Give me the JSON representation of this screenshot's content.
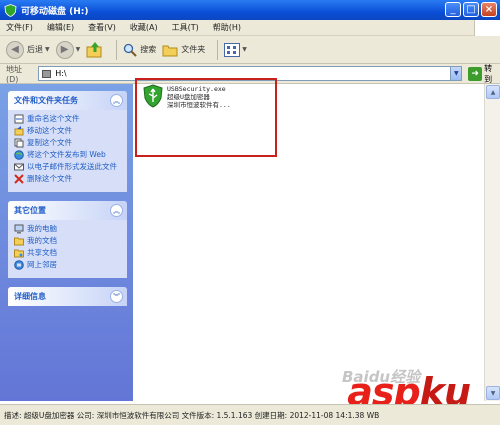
{
  "window": {
    "title": "可移动磁盘 (H:)",
    "buttons": {
      "minimize": "_",
      "maximize": "□",
      "close": "×"
    }
  },
  "menu": [
    "文件(F)",
    "编辑(E)",
    "查看(V)",
    "收藏(A)",
    "工具(T)",
    "帮助(H)"
  ],
  "toolbar": {
    "back_label": "后退",
    "search_label": "搜索",
    "folders_label": "文件夹"
  },
  "address": {
    "label": "地址(D)",
    "value": "H:\\",
    "go_label": "转到"
  },
  "tasks_panel": {
    "title": "文件和文件夹任务",
    "items": [
      {
        "label": "重命名这个文件",
        "icon": "rename-icon"
      },
      {
        "label": "移动这个文件",
        "icon": "move-icon"
      },
      {
        "label": "复制这个文件",
        "icon": "copy-icon"
      },
      {
        "label": "将这个文件发布到 Web",
        "icon": "web-publish-icon"
      },
      {
        "label": "以电子邮件形式发送此文件",
        "icon": "email-icon"
      },
      {
        "label": "删除这个文件",
        "icon": "delete-icon"
      }
    ]
  },
  "places_panel": {
    "title": "其它位置",
    "items": [
      {
        "label": "我的电脑",
        "icon": "computer-icon"
      },
      {
        "label": "我的文档",
        "icon": "documents-folder-icon"
      },
      {
        "label": "共享文档",
        "icon": "shared-folder-icon"
      },
      {
        "label": "网上邻居",
        "icon": "network-icon"
      }
    ]
  },
  "details_panel": {
    "title": "详细信息"
  },
  "file": {
    "name": "USBSecurity.exe",
    "description": "超级U盘加密器",
    "company": "深圳市恒波软件有..."
  },
  "statusbar": {
    "text": "描述: 超级U盘加密器 公司: 深圳市恒波软件有限公司 文件版本: 1.5.1.163 创建日期: 2012-11-08 14:1.38 WB"
  },
  "watermarks": {
    "baidu": "Baidu经验",
    "site": "asp",
    "site_suffix": "ku"
  },
  "colors": {
    "title_bar": "#0a4fd6",
    "side_pane": "#6f8be0",
    "panel_link": "#215dc6",
    "highlight_box": "#c8201c"
  }
}
